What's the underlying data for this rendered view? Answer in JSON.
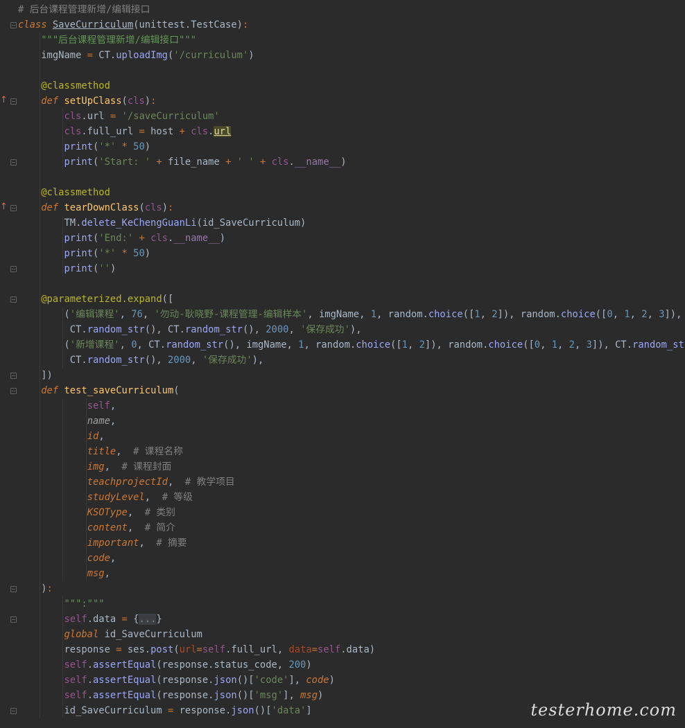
{
  "editor": {
    "lines": [
      [
        [
          "cmt",
          "# 后台课程管理新增/编辑接口"
        ]
      ],
      [
        [
          "kw",
          "class "
        ],
        [
          "def",
          "SaveCurriculum"
        ],
        [
          "pl",
          "(unittest.TestCase)"
        ],
        [
          "op",
          ":"
        ]
      ],
      [
        [
          "pl",
          "    "
        ],
        [
          "doc",
          "\"\"\"后台课程管理新增/编辑接口\"\"\""
        ]
      ],
      [
        [
          "pl",
          "    imgName "
        ],
        [
          "op",
          "="
        ],
        [
          "pl",
          " CT."
        ],
        [
          "meth",
          "uploadImg"
        ],
        [
          "pl",
          "("
        ],
        [
          "str",
          "'/curriculum'"
        ],
        [
          "pl",
          ")"
        ]
      ],
      [],
      [
        [
          "pl",
          "    "
        ],
        [
          "deco",
          "@classmethod"
        ]
      ],
      [
        [
          "pl",
          "    "
        ],
        [
          "kw",
          "def "
        ],
        [
          "fn",
          "setUpClass"
        ],
        [
          "pl",
          "("
        ],
        [
          "self",
          "cls"
        ],
        [
          "pl",
          ")"
        ],
        [
          "op",
          ":"
        ]
      ],
      [
        [
          "pl",
          "        "
        ],
        [
          "self",
          "cls"
        ],
        [
          "pl",
          "."
        ],
        [
          "pl",
          "url "
        ],
        [
          "op",
          "="
        ],
        [
          "pl",
          " "
        ],
        [
          "str",
          "'/saveCurriculum'"
        ]
      ],
      [
        [
          "pl",
          "        "
        ],
        [
          "self",
          "cls"
        ],
        [
          "pl",
          ".full_url "
        ],
        [
          "op",
          "="
        ],
        [
          "pl",
          " host "
        ],
        [
          "op",
          "+"
        ],
        [
          "pl",
          " "
        ],
        [
          "self",
          "cls"
        ],
        [
          "pl",
          "."
        ],
        [
          "hl",
          "url"
        ]
      ],
      [
        [
          "pl",
          "        "
        ],
        [
          "meth",
          "print"
        ],
        [
          "pl",
          "("
        ],
        [
          "str",
          "'*'"
        ],
        [
          "pl",
          " "
        ],
        [
          "op",
          "*"
        ],
        [
          "pl",
          " "
        ],
        [
          "num",
          "50"
        ],
        [
          "pl",
          ")"
        ]
      ],
      [
        [
          "pl",
          "        "
        ],
        [
          "meth",
          "print"
        ],
        [
          "pl",
          "("
        ],
        [
          "str",
          "'Start: '"
        ],
        [
          "pl",
          " "
        ],
        [
          "op",
          "+"
        ],
        [
          "pl",
          " file_name "
        ],
        [
          "op",
          "+"
        ],
        [
          "pl",
          " "
        ],
        [
          "str",
          "' '"
        ],
        [
          "pl",
          " "
        ],
        [
          "op",
          "+"
        ],
        [
          "pl",
          " "
        ],
        [
          "self",
          "cls"
        ],
        [
          "pl",
          "."
        ],
        [
          "attr",
          "__name__"
        ],
        [
          "pl",
          ")"
        ]
      ],
      [],
      [
        [
          "pl",
          "    "
        ],
        [
          "deco",
          "@classmethod"
        ]
      ],
      [
        [
          "pl",
          "    "
        ],
        [
          "kw",
          "def "
        ],
        [
          "fn",
          "tearDownClass"
        ],
        [
          "pl",
          "("
        ],
        [
          "self",
          "cls"
        ],
        [
          "pl",
          ")"
        ],
        [
          "op",
          ":"
        ]
      ],
      [
        [
          "pl",
          "        TM."
        ],
        [
          "meth",
          "delete_KeChengGuanLi"
        ],
        [
          "pl",
          "(id_SaveCurriculum)"
        ]
      ],
      [
        [
          "pl",
          "        "
        ],
        [
          "meth",
          "print"
        ],
        [
          "pl",
          "("
        ],
        [
          "str",
          "'End:'"
        ],
        [
          "pl",
          " "
        ],
        [
          "op",
          "+"
        ],
        [
          "pl",
          " "
        ],
        [
          "self",
          "cls"
        ],
        [
          "pl",
          "."
        ],
        [
          "attr",
          "__name__"
        ],
        [
          "pl",
          ")"
        ]
      ],
      [
        [
          "pl",
          "        "
        ],
        [
          "meth",
          "print"
        ],
        [
          "pl",
          "("
        ],
        [
          "str",
          "'*'"
        ],
        [
          "pl",
          " "
        ],
        [
          "op",
          "*"
        ],
        [
          "pl",
          " "
        ],
        [
          "num",
          "50"
        ],
        [
          "pl",
          ")"
        ]
      ],
      [
        [
          "pl",
          "        "
        ],
        [
          "meth",
          "print"
        ],
        [
          "pl",
          "("
        ],
        [
          "str",
          "''"
        ],
        [
          "pl",
          ")"
        ]
      ],
      [],
      [
        [
          "pl",
          "    "
        ],
        [
          "deco",
          "@parameterized.expand"
        ],
        [
          "pl",
          "(["
        ]
      ],
      [
        [
          "pl",
          "        ("
        ],
        [
          "str",
          "'编辑课程'"
        ],
        [
          "pl",
          ", "
        ],
        [
          "num",
          "76"
        ],
        [
          "pl",
          ", "
        ],
        [
          "str",
          "'勿动-耿晓野-课程管理-编辑样本'"
        ],
        [
          "pl",
          ", imgName, "
        ],
        [
          "num",
          "1"
        ],
        [
          "pl",
          ", random."
        ],
        [
          "meth",
          "choice"
        ],
        [
          "pl",
          "(["
        ],
        [
          "num",
          "1"
        ],
        [
          "pl",
          ", "
        ],
        [
          "num",
          "2"
        ],
        [
          "pl",
          "]), random."
        ],
        [
          "meth",
          "choice"
        ],
        [
          "pl",
          "(["
        ],
        [
          "num",
          "0"
        ],
        [
          "pl",
          ", "
        ],
        [
          "num",
          "1"
        ],
        [
          "pl",
          ", "
        ],
        [
          "num",
          "2"
        ],
        [
          "pl",
          ", "
        ],
        [
          "num",
          "3"
        ],
        [
          "pl",
          "]),"
        ]
      ],
      [
        [
          "pl",
          "         CT."
        ],
        [
          "meth",
          "random_str"
        ],
        [
          "pl",
          "(), CT."
        ],
        [
          "meth",
          "random_str"
        ],
        [
          "pl",
          "(), "
        ],
        [
          "num",
          "2000"
        ],
        [
          "pl",
          ", "
        ],
        [
          "str",
          "'保存成功'"
        ],
        [
          "pl",
          "),"
        ]
      ],
      [
        [
          "pl",
          "        ("
        ],
        [
          "str",
          "'新增课程'"
        ],
        [
          "pl",
          ", "
        ],
        [
          "num",
          "0"
        ],
        [
          "pl",
          ", CT."
        ],
        [
          "meth",
          "random_str"
        ],
        [
          "pl",
          "(), imgName, "
        ],
        [
          "num",
          "1"
        ],
        [
          "pl",
          ", random."
        ],
        [
          "meth",
          "choice"
        ],
        [
          "pl",
          "(["
        ],
        [
          "num",
          "1"
        ],
        [
          "pl",
          ", "
        ],
        [
          "num",
          "2"
        ],
        [
          "pl",
          "]), random."
        ],
        [
          "meth",
          "choice"
        ],
        [
          "pl",
          "(["
        ],
        [
          "num",
          "0"
        ],
        [
          "pl",
          ", "
        ],
        [
          "num",
          "1"
        ],
        [
          "pl",
          ", "
        ],
        [
          "num",
          "2"
        ],
        [
          "pl",
          ", "
        ],
        [
          "num",
          "3"
        ],
        [
          "pl",
          "]), CT."
        ],
        [
          "meth",
          "random_str"
        ],
        [
          "pl",
          "(),"
        ]
      ],
      [
        [
          "pl",
          "         CT."
        ],
        [
          "meth",
          "random_str"
        ],
        [
          "pl",
          "(), "
        ],
        [
          "num",
          "2000"
        ],
        [
          "pl",
          ", "
        ],
        [
          "str",
          "'保存成功'"
        ],
        [
          "pl",
          "),"
        ]
      ],
      [
        [
          "pl",
          "    ])"
        ]
      ],
      [
        [
          "pl",
          "    "
        ],
        [
          "kw",
          "def "
        ],
        [
          "fn",
          "test_saveCurriculum"
        ],
        [
          "pl",
          "("
        ]
      ],
      [
        [
          "pl",
          "            "
        ],
        [
          "self",
          "self"
        ],
        [
          "pl",
          ","
        ]
      ],
      [
        [
          "pl",
          "            "
        ],
        [
          "paramg",
          "name"
        ],
        [
          "pl",
          ","
        ]
      ],
      [
        [
          "pl",
          "            "
        ],
        [
          "param",
          "id"
        ],
        [
          "pl",
          ","
        ]
      ],
      [
        [
          "pl",
          "            "
        ],
        [
          "param",
          "title"
        ],
        [
          "pl",
          ",  "
        ],
        [
          "cmt",
          "# 课程名称"
        ]
      ],
      [
        [
          "pl",
          "            "
        ],
        [
          "param",
          "img"
        ],
        [
          "pl",
          ",  "
        ],
        [
          "cmt",
          "# 课程封面"
        ]
      ],
      [
        [
          "pl",
          "            "
        ],
        [
          "param",
          "teachprojectId"
        ],
        [
          "pl",
          ",  "
        ],
        [
          "cmt",
          "# 教学项目"
        ]
      ],
      [
        [
          "pl",
          "            "
        ],
        [
          "param",
          "studyLevel"
        ],
        [
          "pl",
          ",  "
        ],
        [
          "cmt",
          "# 等级"
        ]
      ],
      [
        [
          "pl",
          "            "
        ],
        [
          "param",
          "KSOType"
        ],
        [
          "pl",
          ",  "
        ],
        [
          "cmt",
          "# 类别"
        ]
      ],
      [
        [
          "pl",
          "            "
        ],
        [
          "param",
          "content"
        ],
        [
          "pl",
          ",  "
        ],
        [
          "cmt",
          "# 简介"
        ]
      ],
      [
        [
          "pl",
          "            "
        ],
        [
          "param",
          "important"
        ],
        [
          "pl",
          ",  "
        ],
        [
          "cmt",
          "# 摘要"
        ]
      ],
      [
        [
          "pl",
          "            "
        ],
        [
          "param",
          "code"
        ],
        [
          "pl",
          ","
        ]
      ],
      [
        [
          "pl",
          "            "
        ],
        [
          "param",
          "msg"
        ],
        [
          "pl",
          ","
        ]
      ],
      [
        [
          "pl",
          "    )"
        ],
        [
          "op",
          ":"
        ]
      ],
      [
        [
          "pl",
          "        "
        ],
        [
          "doc",
          "\"\"\":\"\"\""
        ]
      ],
      [
        [
          "pl",
          "        "
        ],
        [
          "self",
          "self"
        ],
        [
          "pl",
          ".data "
        ],
        [
          "op",
          "="
        ],
        [
          "pl",
          " {"
        ],
        [
          "fold",
          "..."
        ],
        [
          "pl",
          "}"
        ]
      ],
      [
        [
          "pl",
          "        "
        ],
        [
          "kw",
          "global "
        ],
        [
          "pl",
          "id_SaveCurriculum"
        ]
      ],
      [
        [
          "pl",
          "        response "
        ],
        [
          "op",
          "="
        ],
        [
          "pl",
          " ses."
        ],
        [
          "meth",
          "post"
        ],
        [
          "pl",
          "("
        ],
        [
          "kwarg",
          "url"
        ],
        [
          "op",
          "="
        ],
        [
          "self",
          "self"
        ],
        [
          "pl",
          ".full_url, "
        ],
        [
          "kwarg",
          "data"
        ],
        [
          "op",
          "="
        ],
        [
          "self",
          "self"
        ],
        [
          "pl",
          ".data)"
        ]
      ],
      [
        [
          "pl",
          "        "
        ],
        [
          "self",
          "self"
        ],
        [
          "pl",
          "."
        ],
        [
          "meth",
          "assertEqual"
        ],
        [
          "pl",
          "(response.status_code, "
        ],
        [
          "num",
          "200"
        ],
        [
          "pl",
          ")"
        ]
      ],
      [
        [
          "pl",
          "        "
        ],
        [
          "self",
          "self"
        ],
        [
          "pl",
          "."
        ],
        [
          "meth",
          "assertEqual"
        ],
        [
          "pl",
          "(response."
        ],
        [
          "meth",
          "json"
        ],
        [
          "pl",
          "()["
        ],
        [
          "str",
          "'code'"
        ],
        [
          "pl",
          "], "
        ],
        [
          "param",
          "code"
        ],
        [
          "pl",
          ")"
        ]
      ],
      [
        [
          "pl",
          "        "
        ],
        [
          "self",
          "self"
        ],
        [
          "pl",
          "."
        ],
        [
          "meth",
          "assertEqual"
        ],
        [
          "pl",
          "(response."
        ],
        [
          "meth",
          "json"
        ],
        [
          "pl",
          "()["
        ],
        [
          "str",
          "'msg'"
        ],
        [
          "pl",
          "], "
        ],
        [
          "param",
          "msg"
        ],
        [
          "pl",
          ")"
        ]
      ],
      [
        [
          "pl",
          "        id_SaveCurriculum "
        ],
        [
          "op",
          "="
        ],
        [
          "pl",
          " response."
        ],
        [
          "meth",
          "json"
        ],
        [
          "pl",
          "()["
        ],
        [
          "str",
          "'data'"
        ],
        [
          "pl",
          "]"
        ]
      ]
    ]
  },
  "watermark": {
    "text": "testerhome.com"
  }
}
